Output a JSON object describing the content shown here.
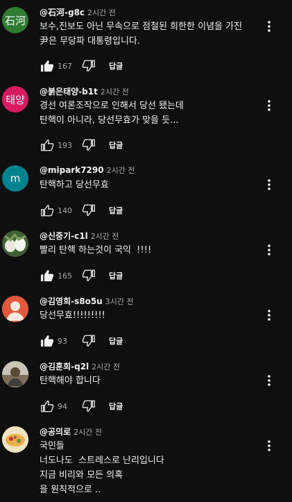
{
  "comments": [
    {
      "author": "@石河-g8c",
      "time": "2시간 전",
      "avatar_text": "石河",
      "avatar_color": "#2e7d32",
      "lines": [
        "보수,진보도 아닌 무속으로 점철된 희한한 이념을 가진",
        "尹은 무당파 대통령입니다."
      ],
      "likes": "167",
      "liked": true,
      "reply_label": "답글"
    },
    {
      "author": "@붉은태양-b1t",
      "time": "2시간 전",
      "avatar_text": "태양",
      "avatar_color": "#d81b60",
      "lines": [
        "경선 여론조작으로 인해서 당선 됐는데",
        "탄핵이 아니라, 당선무효가 맞을 듯..."
      ],
      "likes": "193",
      "liked": false,
      "reply_label": "답글"
    },
    {
      "author": "@mipark7290",
      "time": "2시간 전",
      "avatar_text": "m",
      "avatar_color": "#00838f",
      "lines": [
        "탄핵하고 당선무효"
      ],
      "likes": "140",
      "liked": false,
      "reply_label": "답글"
    },
    {
      "author": "@신중기-c1l",
      "time": "2시간 전",
      "avatar_text": "",
      "avatar_color": "#4a6a3a",
      "lines": [
        "빨리 탄핵 하는것이 국익  !!!!"
      ],
      "likes": "165",
      "liked": true,
      "reply_label": "답글"
    },
    {
      "author": "@김영희-s8o5u",
      "time": "3시간 전",
      "avatar_text": "",
      "avatar_color": "#e25a3a",
      "lines": [
        "당선무효!!!!!!!!!"
      ],
      "likes": "93",
      "liked": true,
      "reply_label": "답글"
    },
    {
      "author": "@김훈희-q2l",
      "time": "2시간 전",
      "avatar_text": "",
      "avatar_color": "#8a8a7a",
      "lines": [
        "탄핵해야 합니다"
      ],
      "likes": "94",
      "liked": false,
      "reply_label": "답글"
    },
    {
      "author": "@공의로",
      "time": "2시간 전",
      "avatar_text": "",
      "avatar_color": "#d9c9a0",
      "lines": [
        "국민들",
        "너도나도  스트레스로 난리입니다",
        "지금 비리와 모든 의혹",
        "을 원칙적으로 .."
      ],
      "likes": "",
      "liked": false,
      "reply_label": ""
    }
  ]
}
